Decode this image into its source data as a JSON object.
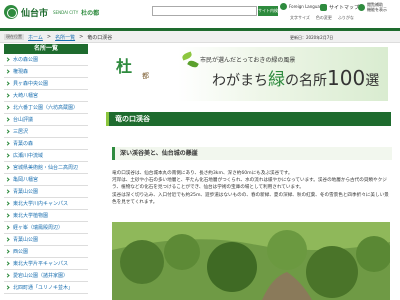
{
  "header": {
    "logo_text": "仙台市",
    "logo_sub": "SENDAI CITY",
    "logo_sub2": "杜の都",
    "search_label": "サイト内検索",
    "lang_label": "Foreign Language",
    "sitemap_label": "サイトマップ",
    "accessibility_label": "閲覧補助",
    "accessibility_label2": "機能を表示",
    "small_links": [
      "文字サイズ",
      "色の変更",
      "ふりがな"
    ]
  },
  "breadcrumb": {
    "label": "現在位置",
    "items": [
      "ホーム",
      "名所一覧"
    ],
    "current": "竜の口渓谷"
  },
  "update": "更新日：2020年2月7日",
  "sidebar": {
    "title": "名所一覧",
    "items": [
      "水の森公園",
      "権現森",
      "貝ヶ森中央公園",
      "大崎八幡宮",
      "北六番丁公園（六坊高蔵園）",
      "台山評議",
      "三居沢",
      "青葉の森",
      "広瀬川中流域",
      "宮城県美術館・仙台二高周辺",
      "亀岡八幡宮",
      "青葉山公園",
      "東北大学川内キャンパス",
      "東北大学植物園",
      "経ヶ峯（瑞鳳殿周辺）",
      "青葉山公園",
      "西公園",
      "東北大学片平キャンパス",
      "愛宕山公園（諸井家園）",
      "北四町通「ユリノキ並木」"
    ]
  },
  "banner": {
    "calli": "杜",
    "calli2": "都",
    "sub": "市民が選んだとっておきの緑の風景",
    "main_a": "わがまち",
    "main_g": "緑",
    "main_b": "の名所",
    "main_num": "100",
    "main_c": "選"
  },
  "page_title": "竜の口渓谷",
  "section_title": "深い渓谷美と、仙台城の懸崖",
  "body": [
    "竜の口渓谷は、仙台城本丸の南側にあり、長さ約3km、深さ約60mにも及ぶ渓谷です。",
    "河岸は、土砂や小石の多い地層と、平たん化石地層がつくられ、水の流れは緩やかになっています。渓谷の地層から古代の貝類やクジラ、植物などの化石を見つけることができ、仙台は学術の宝庫の場として利用されています。",
    "渓谷は深く切り込み、入口付近でも約25m、遊歩道はないものの、春の新緑、夏の深緑、秋の紅葉、冬の雪景色と四季折々に美しい景色を見せてくれます。"
  ],
  "colors": {
    "brand": "#1e6b2e",
    "accent": "#2e8b3e",
    "link": "#1a6fb0"
  }
}
